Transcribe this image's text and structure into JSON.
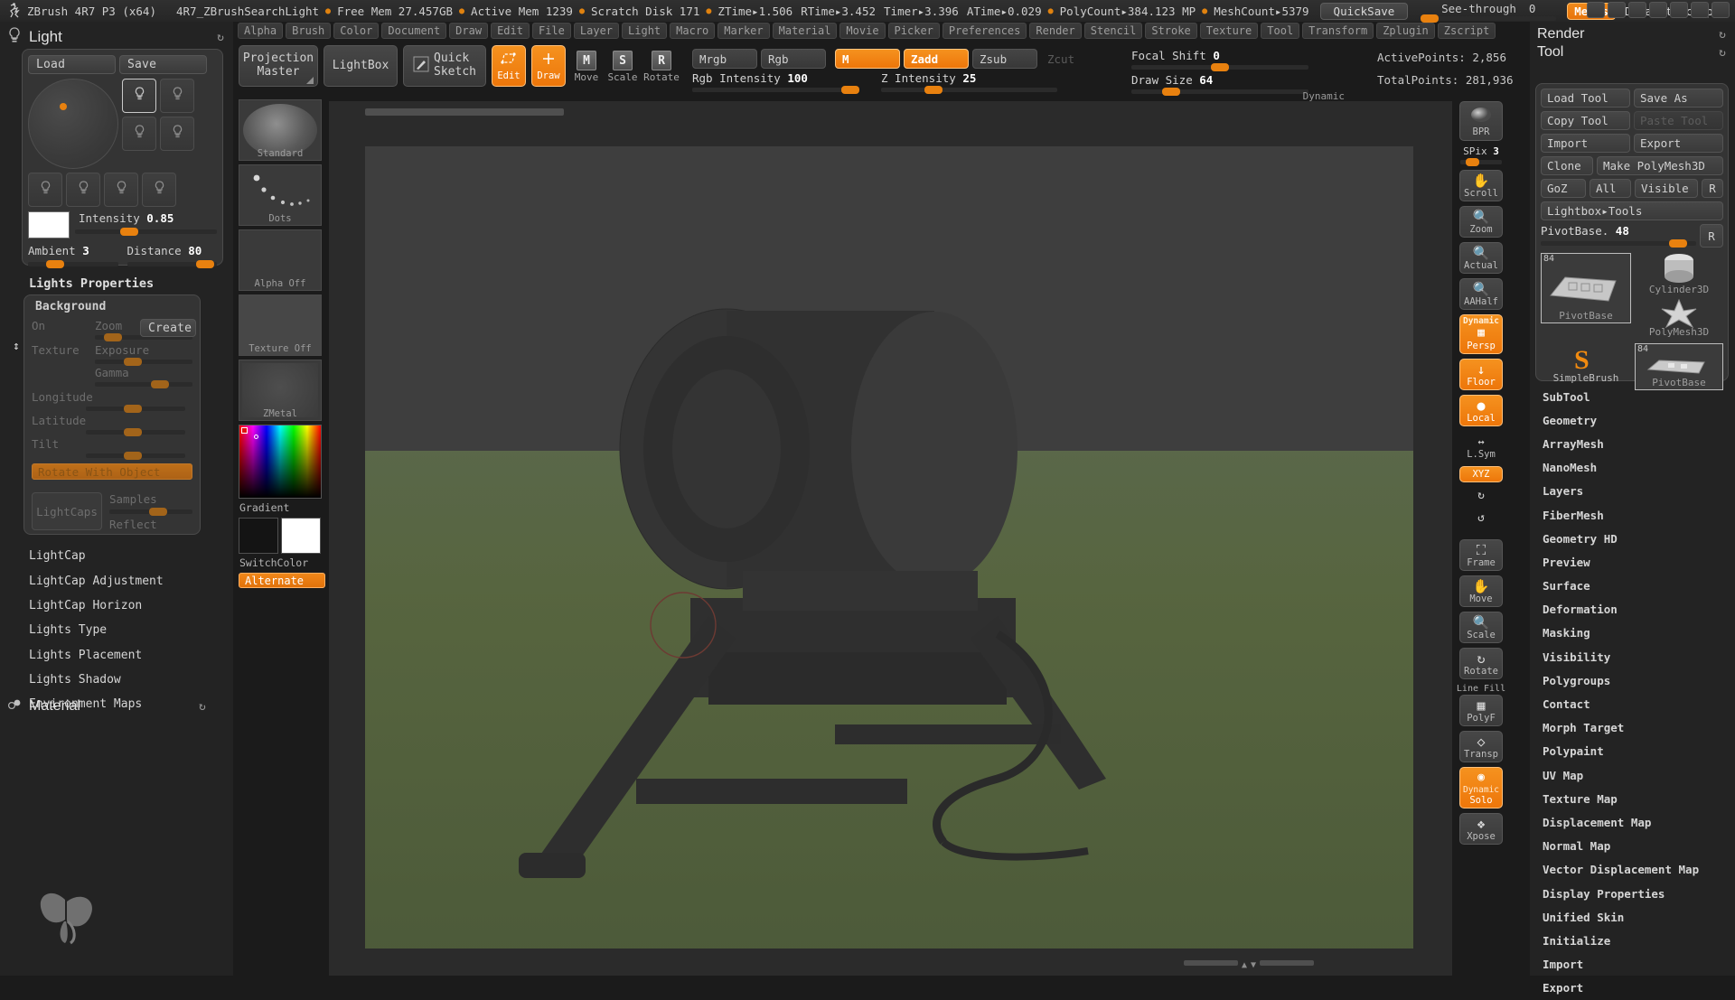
{
  "titlebar": {
    "app": "ZBrush 4R7 P3 (x64)",
    "document": "4R7_ZBrushSearchLight",
    "free_mem": "Free Mem 27.457GB",
    "active_mem": "Active Mem 1239",
    "scratch_disk": "Scratch Disk 171",
    "ztime": "ZTime▸1.506",
    "rtime": "RTime▸3.452",
    "timer": "Timer▸3.396",
    "atime": "ATime▸0.029",
    "polycount": "PolyCount▸384.123 MP",
    "meshcount": "MeshCount▸5379",
    "quicksave": "QuickSave",
    "see_through_label": "See-through",
    "see_through_value": "0",
    "menus": "Menus",
    "default_zscript": "DefaultZScript"
  },
  "menubar": {
    "items": [
      "Alpha",
      "Brush",
      "Color",
      "Document",
      "Draw",
      "Edit",
      "File",
      "Layer",
      "Light",
      "Macro",
      "Marker",
      "Material",
      "Movie",
      "Picker",
      "Preferences",
      "Render",
      "Stencil",
      "Stroke",
      "Texture",
      "Tool",
      "Transform",
      "Zplugin",
      "Zscript"
    ]
  },
  "light_palette": {
    "title": "Light",
    "load": "Load",
    "save": "Save",
    "intensity_label": "Intensity",
    "intensity_value": "0.85",
    "ambient_label": "Ambient",
    "ambient_value": "3",
    "distance_label": "Distance",
    "distance_value": "80",
    "properties_title": "Lights Properties",
    "background": {
      "title": "Background",
      "on": "On",
      "zoom": "Zoom",
      "exposure": "Exposure",
      "gamma": "Gamma",
      "create": "Create",
      "texture": "Texture",
      "longitude": "Longitude",
      "latitude": "Latitude",
      "tilt": "Tilt",
      "rotate_with_object": "Rotate With Object",
      "lightcaps": "LightCaps",
      "samples": "Samples",
      "reflect": "Reflect"
    },
    "subpalettes": [
      "LightCap",
      "LightCap Adjustment",
      "LightCap Horizon",
      "Lights Type",
      "Lights Placement",
      "Lights Shadow",
      "Environment Maps"
    ],
    "material_title": "Material"
  },
  "brush_column": {
    "items": [
      {
        "label": "Standard",
        "kind": "brush"
      },
      {
        "label": "Dots",
        "kind": "stroke"
      },
      {
        "label": "Alpha Off",
        "kind": "alpha"
      },
      {
        "label": "Texture Off",
        "kind": "texture"
      },
      {
        "label": "ZMetal",
        "kind": "material"
      }
    ],
    "gradient_label": "Gradient",
    "switch_color": "SwitchColor",
    "alternate": "Alternate"
  },
  "toolbar": {
    "projection_master": "Projection\nMaster",
    "lightbox": "LightBox",
    "quick_sketch": "Quick\nSketch",
    "edit": "Edit",
    "draw": "Draw",
    "move": "Move",
    "scale": "Scale",
    "rotate": "Rotate",
    "mrgb": "Mrgb",
    "rgb": "Rgb",
    "m": "M",
    "zadd": "Zadd",
    "zsub": "Zsub",
    "zcut": "Zcut",
    "rgb_intensity_label": "Rgb Intensity",
    "rgb_intensity_value": "100",
    "z_intensity_label": "Z Intensity",
    "z_intensity_value": "25",
    "focal_shift_label": "Focal Shift",
    "focal_shift_value": "0",
    "draw_size_label": "Draw Size",
    "draw_size_value": "64",
    "dynamic": "Dynamic",
    "active_points": "ActivePoints: 2,856",
    "total_points": "TotalPoints: 281,936"
  },
  "right_tools": {
    "bpr": "BPR",
    "spix_label": "SPix",
    "spix_value": "3",
    "scroll": "Scroll",
    "zoom": "Zoom",
    "actual": "Actual",
    "aahalf": "AAHalf",
    "dynamic": "Dynamic",
    "persp": "Persp",
    "floor": "Floor",
    "local": "Local",
    "lsym": "L.Sym",
    "xyz": "XYZ",
    "frame": "Frame",
    "move": "Move",
    "scale": "Scale",
    "rotate": "Rotate",
    "line_fill": "Line Fill",
    "polyf": "PolyF",
    "transp": "Transp",
    "solo": "Solo",
    "xpose": "Xpose"
  },
  "tool_palette": {
    "render_title": "Render",
    "tool_title": "Tool",
    "load_tool": "Load Tool",
    "save_as": "Save As",
    "copy_tool": "Copy Tool",
    "paste_tool": "Paste Tool",
    "import": "Import",
    "export": "Export",
    "clone": "Clone",
    "make_polymesh3d": "Make PolyMesh3D",
    "goz": "GoZ",
    "all": "All",
    "visible": "Visible",
    "r": "R",
    "lightbox_tools": "Lightbox▸Tools",
    "pivotbase_label": "PivotBase.",
    "pivotbase_value": "48",
    "thumbs": [
      {
        "label": "PivotBase",
        "badge": "84",
        "selected": true
      },
      {
        "label": "Cylinder3D",
        "badge": "",
        "selected": false
      },
      {
        "label": "PolyMesh3D",
        "badge": "",
        "selected": false
      },
      {
        "label": "SimpleBrush",
        "badge": "",
        "selected": false
      },
      {
        "label": "PivotBase",
        "badge": "84",
        "selected": true
      }
    ],
    "subpalettes": [
      "SubTool",
      "Geometry",
      "ArrayMesh",
      "NanoMesh",
      "Layers",
      "FiberMesh",
      "Geometry HD",
      "Preview",
      "Surface",
      "Deformation",
      "Masking",
      "Visibility",
      "Polygroups",
      "Contact",
      "Morph Target",
      "Polypaint",
      "UV Map",
      "Texture Map",
      "Displacement Map",
      "Normal Map",
      "Vector Displacement Map",
      "Display Properties",
      "Unified Skin",
      "Initialize",
      "Import",
      "Export"
    ]
  },
  "colors": {
    "accent": "#ed7a0c",
    "panel_bg": "#343434",
    "app_bg": "#232323",
    "canvas_bg": "#3e3e3e",
    "ground_green": "#59683f"
  }
}
